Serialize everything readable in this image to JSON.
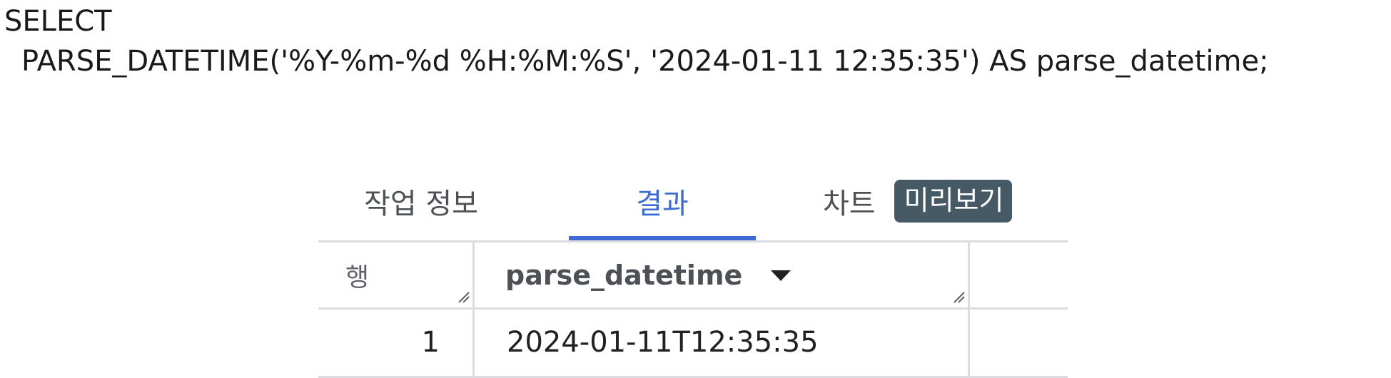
{
  "query": {
    "line1": "SELECT",
    "line2": "PARSE_DATETIME('%Y-%m-%d %H:%M:%S', '2024-01-11 12:35:35') AS parse_datetime;"
  },
  "tabs": {
    "job_info": "작업 정보",
    "results": "결과",
    "chart": "차트",
    "preview_badge": "미리보기",
    "active": "results",
    "accent_color": "#3c6bd4"
  },
  "table": {
    "row_header": "행",
    "columns": [
      "parse_datetime"
    ],
    "rows": [
      {
        "row": "1",
        "parse_datetime": "2024-01-11T12:35:35"
      }
    ]
  },
  "icons": {
    "sort": "sort-down-icon",
    "resize": "column-resize-icon"
  }
}
